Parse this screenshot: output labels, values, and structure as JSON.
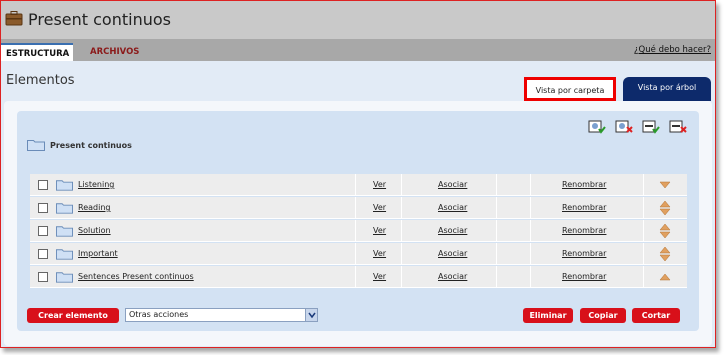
{
  "window": {
    "title": "Present continuos"
  },
  "tabs": {
    "estructura": "ESTRUCTURA",
    "archivos": "ARCHIVOS",
    "help": "¿Qué debo hacer?"
  },
  "main": {
    "title": "Elementos"
  },
  "views": {
    "carpeta": "Vista por carpeta",
    "arbol": "Vista por árbol"
  },
  "root_folder": "Present continuos",
  "rows": [
    {
      "name": "Listening",
      "ver": "Ver",
      "asociar": "Asociar",
      "renombrar": "Renombrar",
      "arrows": "down"
    },
    {
      "name": "Reading",
      "ver": "Ver",
      "asociar": "Asociar",
      "renombrar": "Renombrar",
      "arrows": "both"
    },
    {
      "name": "Solution",
      "ver": "Ver",
      "asociar": "Asociar",
      "renombrar": "Renombrar",
      "arrows": "both"
    },
    {
      "name": "Important",
      "ver": "Ver",
      "asociar": "Asociar",
      "renombrar": "Renombrar",
      "arrows": "both"
    },
    {
      "name": "Sentences Present continuos",
      "ver": "Ver",
      "asociar": "Asociar",
      "renombrar": "Renombrar",
      "arrows": "up"
    }
  ],
  "actions": {
    "crear": "Crear elemento",
    "otras": "Otras acciones",
    "eliminar": "Eliminar",
    "copiar": "Copiar",
    "cortar": "Cortar"
  },
  "colors": {
    "accent_red": "#d8101a",
    "dark_blue": "#0d2a6b",
    "panel_blue": "#d3e2f3",
    "arrow_orange": "#e0a060"
  }
}
